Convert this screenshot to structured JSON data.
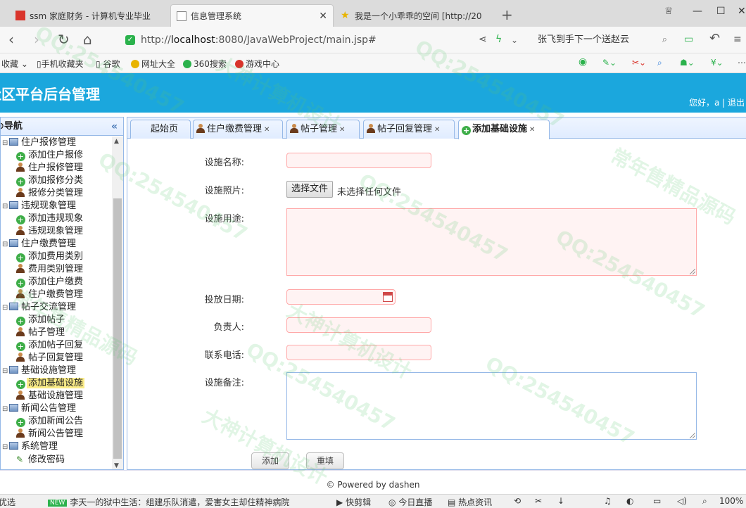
{
  "browser": {
    "tabs": [
      {
        "label": "ssm 家庭财务 - 计算机专业毕业"
      },
      {
        "label": "信息管理系统"
      },
      {
        "label": "我是一个小乖乖的空间 [http://20"
      }
    ],
    "url_prefix": "http://",
    "url_host": "localhost",
    "url_rest": ":8080/JavaWebProject/main.jsp#",
    "search_text": "张飞到手下一个送赵云",
    "bookmarks": [
      "收藏",
      "手机收藏夹",
      "谷歌",
      "网址大全",
      "360搜索",
      "游戏中心"
    ],
    "zoom": "100%"
  },
  "app": {
    "title": "社区平台后台管理",
    "user_text": "您好，a | 退出"
  },
  "sidebar": {
    "title": "导航",
    "items": [
      {
        "label": "住户报修管理",
        "kind": "group"
      },
      {
        "label": "添加住户报修",
        "kind": "add"
      },
      {
        "label": "住户报修管理",
        "kind": "user"
      },
      {
        "label": "添加报修分类",
        "kind": "add"
      },
      {
        "label": "报修分类管理",
        "kind": "user"
      },
      {
        "label": "违规现象管理",
        "kind": "group"
      },
      {
        "label": "添加违规现象",
        "kind": "add"
      },
      {
        "label": "违规现象管理",
        "kind": "user"
      },
      {
        "label": "住户缴费管理",
        "kind": "group"
      },
      {
        "label": "添加费用类别",
        "kind": "add"
      },
      {
        "label": "费用类别管理",
        "kind": "user"
      },
      {
        "label": "添加住户缴费",
        "kind": "add"
      },
      {
        "label": "住户缴费管理",
        "kind": "user"
      },
      {
        "label": "帖子交流管理",
        "kind": "group"
      },
      {
        "label": "添加帖子",
        "kind": "add"
      },
      {
        "label": "帖子管理",
        "kind": "user"
      },
      {
        "label": "添加帖子回复",
        "kind": "add"
      },
      {
        "label": "帖子回复管理",
        "kind": "user"
      },
      {
        "label": "基础设施管理",
        "kind": "group"
      },
      {
        "label": "添加基础设施",
        "kind": "add",
        "selected": true
      },
      {
        "label": "基础设施管理",
        "kind": "user"
      },
      {
        "label": "新闻公告管理",
        "kind": "group"
      },
      {
        "label": "添加新闻公告",
        "kind": "add"
      },
      {
        "label": "新闻公告管理",
        "kind": "user"
      },
      {
        "label": "系统管理",
        "kind": "group"
      },
      {
        "label": "修改密码",
        "kind": "pencil"
      }
    ]
  },
  "content_tabs": [
    {
      "label": "起始页"
    },
    {
      "label": "住户缴费管理"
    },
    {
      "label": "帖子管理"
    },
    {
      "label": "帖子回复管理"
    },
    {
      "label": "添加基础设施"
    }
  ],
  "form": {
    "name_label": "设施名称:",
    "photo_label": "设施照片:",
    "file_button": "选择文件",
    "file_status": "未选择任何文件",
    "usage_label": "设施用途:",
    "date_label": "投放日期:",
    "owner_label": "负责人:",
    "phone_label": "联系电话:",
    "memo_label": "设施备注:",
    "add_button": "添加",
    "reset_button": "重填"
  },
  "footer": "© Powered by dashen",
  "statusbar": {
    "left": "优选",
    "news": "李天一的狱中生活：组建乐队消遣，爱害女主却住精神病院",
    "items": [
      "快剪辑",
      "今日直播",
      "热点资讯"
    ]
  },
  "watermark": [
    "QQ:254540457",
    "大神计算机设计",
    "常年售精品源码"
  ]
}
